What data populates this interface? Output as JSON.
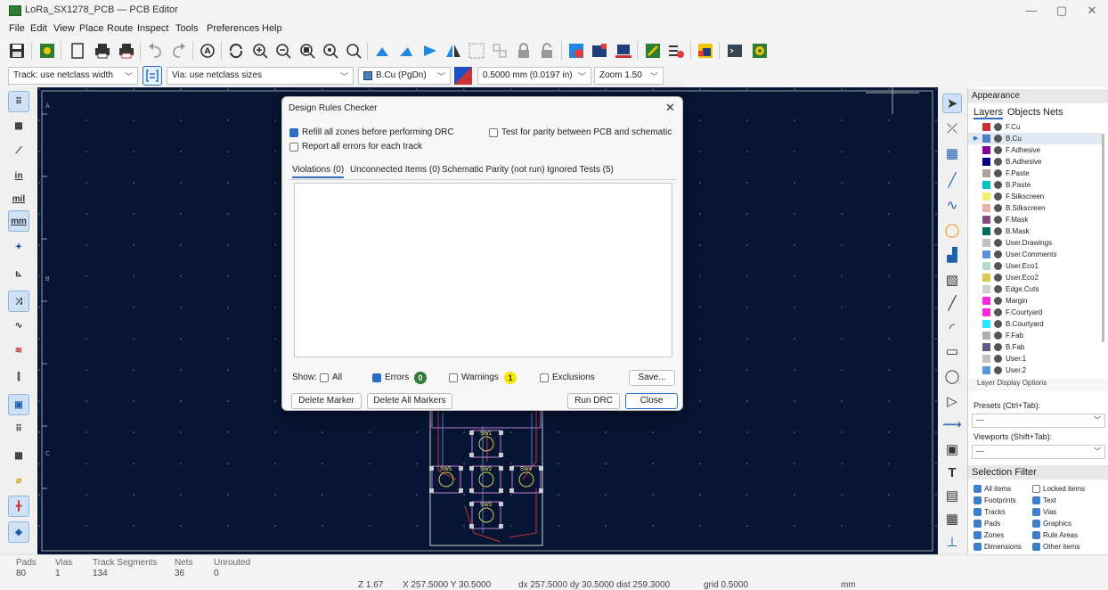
{
  "window": {
    "title": "LoRa_SX1278_PCB — PCB Editor",
    "minimize": "—",
    "maximize": "▢",
    "close": "✕"
  },
  "menu": [
    "File",
    "Edit",
    "View",
    "Place",
    "Route",
    "Inspect",
    "Tools",
    "Preferences",
    "Help"
  ],
  "toolbar": {
    "icons": [
      "save-icon",
      "board-setup-icon",
      "page-settings-icon",
      "print-icon",
      "plot-icon",
      "undo-icon",
      "redo-icon",
      "find-icon",
      "redraw-icon",
      "zoom-in-icon",
      "zoom-out-icon",
      "zoom-fit-icon",
      "zoom-objects-icon",
      "zoom-selection-icon",
      "rotate-ccw-icon",
      "rotate-cw-icon",
      "flip-icon",
      "mirror-icon",
      "group-icon",
      "ungroup-icon",
      "lock-icon",
      "unlock-icon",
      "netlist-icon",
      "footprint-editor-icon",
      "footprint-browser-icon",
      "update-pcb-icon",
      "drc-icon",
      "scripting-icon",
      "python-icon",
      "3d-viewer-icon"
    ]
  },
  "auxbar": {
    "track": "Track: use netclass width",
    "via": "Via: use netclass sizes",
    "layer": "B.Cu (PgDn)",
    "grid": "0.5000 mm (0.0197 in)",
    "zoom": "Zoom 1.50"
  },
  "left_toolbar": [
    "⠿",
    "▦",
    "⟋",
    "in",
    "mil",
    "mm",
    "✦",
    "⊾",
    "⤨",
    "∿",
    "≋",
    "⫿",
    "▣",
    "⠿",
    "▩",
    "⌀",
    "╋",
    "◆"
  ],
  "canvas": {
    "marks": [
      "A",
      "B",
      "C"
    ],
    "components": [
      "SW1",
      "SW2",
      "SW3",
      "SW4",
      "SW5"
    ]
  },
  "right_toolbar": [
    "➤",
    "⤫",
    "▦",
    "╱",
    "∿",
    "◯",
    "▟",
    "▧",
    "╱",
    "◜",
    "▭",
    "◯",
    "▷",
    "⟿",
    "▣",
    "T",
    "▤",
    "▦",
    "⊥"
  ],
  "appearance": {
    "title": "Appearance",
    "tabs": [
      "Layers",
      "Objects",
      "Nets"
    ],
    "layers": [
      {
        "name": "F.Cu",
        "color": "#c83434"
      },
      {
        "name": "B.Cu",
        "color": "#4d7fc4"
      },
      {
        "name": "F.Adhesive",
        "color": "#84009d"
      },
      {
        "name": "B.Adhesive",
        "color": "#00008b"
      },
      {
        "name": "F.Paste",
        "color": "#b4a0a0"
      },
      {
        "name": "B.Paste",
        "color": "#00c2c2"
      },
      {
        "name": "F.Silkscreen",
        "color": "#f2ed6a"
      },
      {
        "name": "B.Silkscreen",
        "color": "#e8b2a7"
      },
      {
        "name": "F.Mask",
        "color": "#844983"
      },
      {
        "name": "B.Mask",
        "color": "#026b5b"
      },
      {
        "name": "User.Drawings",
        "color": "#c2c2c2"
      },
      {
        "name": "User.Comments",
        "color": "#5994dc"
      },
      {
        "name": "User.Eco1",
        "color": "#b4dbd2"
      },
      {
        "name": "User.Eco2",
        "color": "#d8c852"
      },
      {
        "name": "Edge.Cuts",
        "color": "#d0d2cd"
      },
      {
        "name": "Margin",
        "color": "#ff26e2"
      },
      {
        "name": "F.Courtyard",
        "color": "#ff26e2"
      },
      {
        "name": "B.Courtyard",
        "color": "#26e9ff"
      },
      {
        "name": "F.Fab",
        "color": "#afafaf"
      },
      {
        "name": "B.Fab",
        "color": "#585d84"
      },
      {
        "name": "User.1",
        "color": "#c2c2c2"
      },
      {
        "name": "User.2",
        "color": "#5994dc"
      }
    ],
    "display_options": "Layer Display Options",
    "presets_label": "Presets (Ctrl+Tab):",
    "presets_value": "---",
    "viewports_label": "Viewports (Shift+Tab):",
    "viewports_value": "---"
  },
  "selection_filter": {
    "title": "Selection Filter",
    "items": [
      {
        "label": "All items",
        "checked": true
      },
      {
        "label": "Locked items",
        "checked": false
      },
      {
        "label": "Footprints",
        "checked": true
      },
      {
        "label": "Text",
        "checked": true
      },
      {
        "label": "Tracks",
        "checked": true
      },
      {
        "label": "Vias",
        "checked": true
      },
      {
        "label": "Pads",
        "checked": true
      },
      {
        "label": "Graphics",
        "checked": true
      },
      {
        "label": "Zones",
        "checked": true
      },
      {
        "label": "Rule Areas",
        "checked": true
      },
      {
        "label": "Dimensions",
        "checked": true
      },
      {
        "label": "Other items",
        "checked": true
      }
    ]
  },
  "messages": [
    {
      "label": "Pads",
      "value": "80"
    },
    {
      "label": "Vias",
      "value": "1"
    },
    {
      "label": "Track Segments",
      "value": "134"
    },
    {
      "label": "Nets",
      "value": "36"
    },
    {
      "label": "Unrouted",
      "value": "0"
    }
  ],
  "status": {
    "z": "Z 1.67",
    "xy": "X 257.5000  Y 30.5000",
    "dxy": "dx 257.5000  dy 30.5000  dist 259.3000",
    "grid": "grid 0.5000",
    "units": "mm"
  },
  "drc": {
    "title": "Design Rules Checker",
    "refill": "Refill all zones before performing DRC",
    "parity": "Test for parity between PCB and schematic",
    "report_all": "Report all errors for each track",
    "tabs": [
      "Violations (0)",
      "Unconnected Items (0)",
      "Schematic Parity (not run)",
      "Ignored Tests (5)"
    ],
    "show": "Show:",
    "all": "All",
    "errors": "Errors",
    "errors_count": "0",
    "warnings": "Warnings",
    "warnings_count": "1",
    "exclusions": "Exclusions",
    "save": "Save...",
    "delete_marker": "Delete Marker",
    "delete_all": "Delete All Markers",
    "run": "Run DRC",
    "close": "Close"
  }
}
